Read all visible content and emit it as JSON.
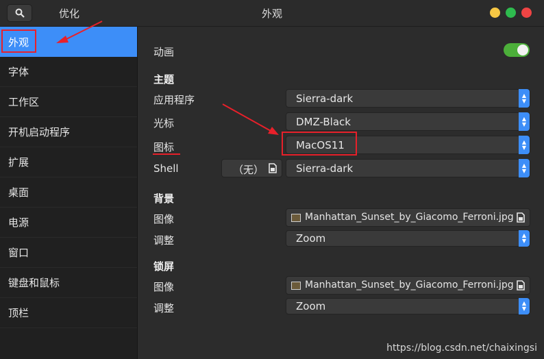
{
  "header": {
    "left_title": "优化",
    "title": "外观"
  },
  "sidebar": {
    "items": [
      {
        "label": "外观"
      },
      {
        "label": "字体"
      },
      {
        "label": "工作区"
      },
      {
        "label": "开机启动程序"
      },
      {
        "label": "扩展"
      },
      {
        "label": "桌面"
      },
      {
        "label": "电源"
      },
      {
        "label": "窗口"
      },
      {
        "label": "键盘和鼠标"
      },
      {
        "label": "顶栏"
      }
    ]
  },
  "main": {
    "animation_label": "动画",
    "animation_enabled": true,
    "themes": {
      "section": "主题",
      "applications_label": "应用程序",
      "applications_value": "Sierra-dark",
      "cursor_label": "光标",
      "cursor_value": "DMZ-Black",
      "icons_label": "图标",
      "icons_value": "MacOS11",
      "shell_label": "Shell",
      "shell_none": "（无）",
      "shell_value": "Sierra-dark"
    },
    "background": {
      "section": "背景",
      "image_label": "图像",
      "image_value": "Manhattan_Sunset_by_Giacomo_Ferroni.jpg",
      "adjust_label": "调整",
      "adjust_value": "Zoom"
    },
    "lockscreen": {
      "section": "锁屏",
      "image_label": "图像",
      "image_value": "Manhattan_Sunset_by_Giacomo_Ferroni.jpg",
      "adjust_label": "调整",
      "adjust_value": "Zoom"
    }
  },
  "watermark": "https://blog.csdn.net/chaixingsi",
  "colors": {
    "accent": "#3d8ef8",
    "toggle_on": "#4caf3a",
    "annotation": "#e8202a"
  }
}
